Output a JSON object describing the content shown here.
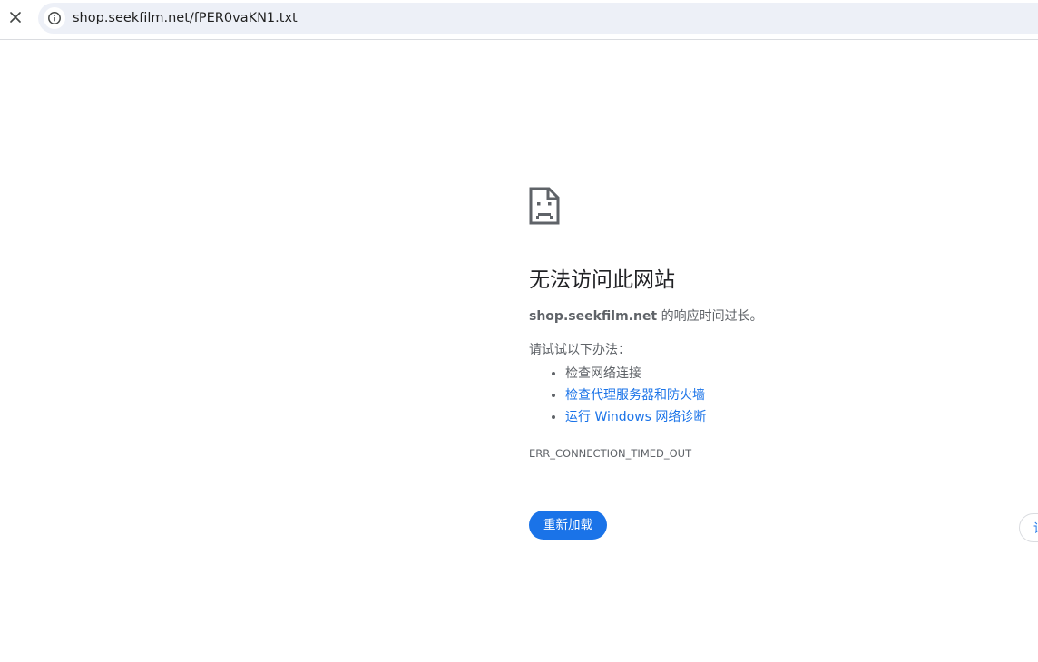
{
  "browser": {
    "close_icon": "close-icon",
    "site_info_icon": "info-icon",
    "url": "shop.seekfilm.net/fPER0vaKN1.txt"
  },
  "error_page": {
    "icon": "sad-file-icon",
    "title": "无法访问此网站",
    "summary_host": "shop.seekfilm.net",
    "summary_text": " 的响应时间过长。",
    "suggestions_heading": "请试试以下办法：",
    "suggestions": [
      {
        "label": "检查网络连接",
        "link": false
      },
      {
        "label": "检查代理服务器和防火墙",
        "link": true
      },
      {
        "label": "运行 Windows 网络诊断",
        "link": true
      }
    ],
    "error_code": "ERR_CONNECTION_TIMED_OUT",
    "reload_label": "重新加载",
    "details_label": "详细信息"
  },
  "colors": {
    "accent": "#1a73e8",
    "omnibox_bg": "#edf0f7",
    "body_text": "#5f6368",
    "title_text": "#202124"
  }
}
